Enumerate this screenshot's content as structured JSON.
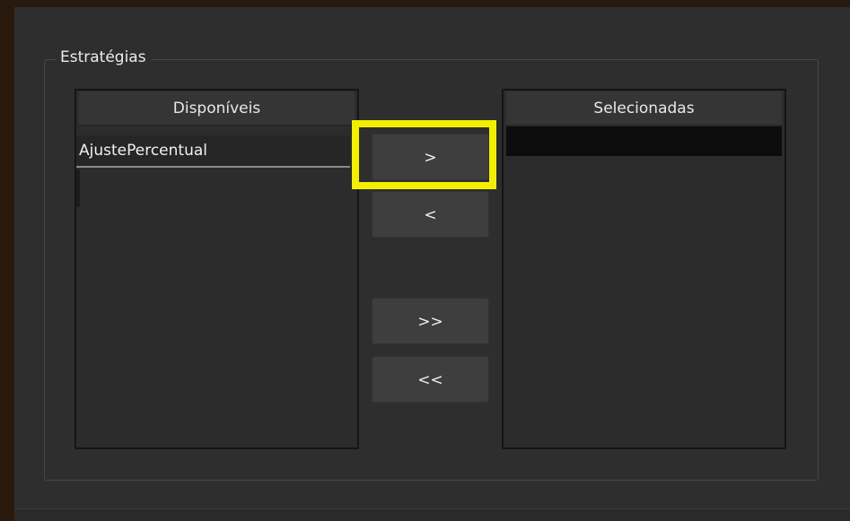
{
  "group": {
    "title": "Estratégias"
  },
  "available": {
    "header": "Disponíveis",
    "items": [
      "AjustePercentual"
    ]
  },
  "selected": {
    "header": "Selecionadas",
    "items": []
  },
  "buttons": {
    "move_one_right": ">",
    "move_one_left": "<",
    "move_all_right": ">>",
    "move_all_left": "<<"
  },
  "colors": {
    "highlight": "#f2f000",
    "panel_background": "#2e2e2e",
    "outer_background": "#2a1a0e"
  }
}
